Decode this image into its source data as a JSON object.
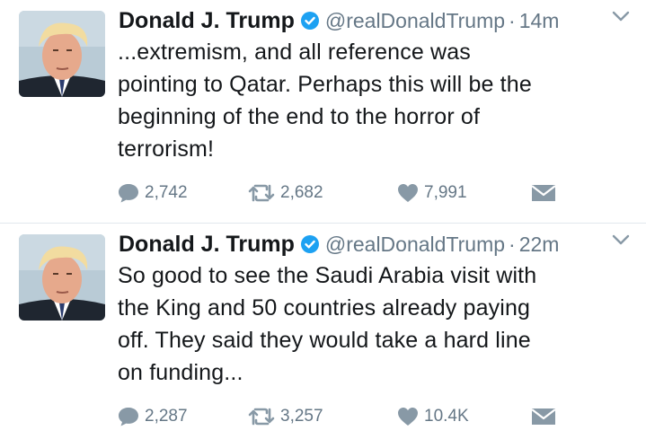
{
  "tweets": [
    {
      "author": "Donald J. Trump",
      "handle": "@realDonaldTrump",
      "separator": "·",
      "time": "14m",
      "text_lines": [
        "...extremism, and all reference was",
        "pointing to Qatar. Perhaps this will be the",
        "beginning of the end to the horror of",
        "terrorism!"
      ],
      "replies": "2,742",
      "retweets": "2,682",
      "likes": "7,991"
    },
    {
      "author": "Donald J. Trump",
      "handle": "@realDonaldTrump",
      "separator": "·",
      "time": "22m",
      "text_lines": [
        "So good to see the Saudi Arabia visit with",
        "the King and 50 countries already paying",
        "off. They said they would take a hard line",
        "on funding..."
      ],
      "replies": "2,287",
      "retweets": "3,257",
      "likes": "10.4K"
    }
  ],
  "icons": {
    "verified": "verified-badge-icon",
    "caret": "chevron-down-icon",
    "reply": "reply-bubble-icon",
    "retweet": "retweet-icon",
    "like": "heart-icon",
    "dm": "envelope-icon"
  },
  "colors": {
    "text": "#14171a",
    "secondary": "#657786",
    "icon": "#8899a6",
    "verified": "#1da1f2",
    "divider": "#e1e8ed"
  }
}
